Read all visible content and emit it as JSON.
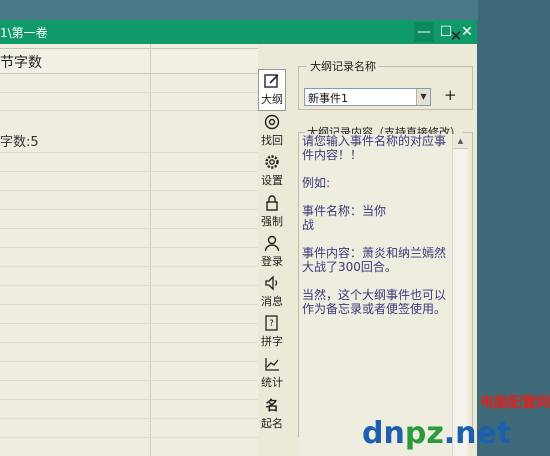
{
  "window": {
    "title": "1\\第一卷"
  },
  "editor": {
    "column_header": "节字数",
    "count_label": "字数:5"
  },
  "toolbar": [
    {
      "label": "大纲",
      "icon": "edit-icon",
      "active": true
    },
    {
      "label": "找回",
      "icon": "recover-icon"
    },
    {
      "label": "设置",
      "icon": "gear-icon"
    },
    {
      "label": "强制",
      "icon": "lock-icon"
    },
    {
      "label": "登录",
      "icon": "user-icon"
    },
    {
      "label": "消息",
      "icon": "speaker-icon"
    },
    {
      "label": "拼字",
      "icon": "spell-icon"
    },
    {
      "label": "统计",
      "icon": "chart-icon"
    },
    {
      "label": "起名",
      "icon": "name-icon"
    }
  ],
  "outline": {
    "name_legend": "大纲记录名称",
    "selected_event": "新事件1",
    "add_label": "+",
    "close_label": "✕",
    "content_legend": "大纲记录内容（支持直接修改）",
    "content": [
      "请您输入事件名称的对应事件内容！！",
      "例如:",
      "事件名称：当你\n战",
      "事件内容：萧炎和纳兰嫣然大战了300回合。",
      "当然，这个大纲事件也可以作为备忘录或者便签使用。"
    ]
  },
  "watermark": {
    "cn": "电脑配置网",
    "url_a": "dn",
    "url_b": "pz",
    "url_c": ".net"
  }
}
